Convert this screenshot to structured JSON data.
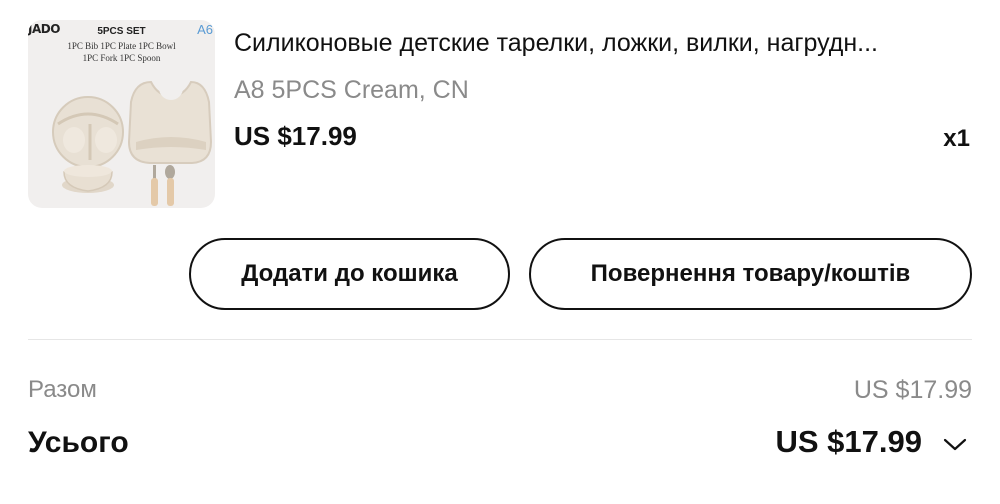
{
  "product": {
    "image": {
      "brand": "JADO",
      "corner_label": "A6",
      "set_label": "5PCS SET",
      "contents_line1": "1PC Bib   1PC Plate   1PC Bowl",
      "contents_line2": "1PC Fork   1PC Spoon"
    },
    "title": "Силиконовые детские тарелки, ложки, вилки, нагрудн...",
    "variant": "A8 5PCS Cream, CN",
    "price": "US $17.99",
    "quantity": "x1"
  },
  "actions": {
    "add_to_cart": "Додати до кошика",
    "return": "Повернення товару/коштів"
  },
  "summary": {
    "subtotal_label": "Разом",
    "subtotal_value": "US $17.99",
    "total_label": "Усього",
    "total_value": "US $17.99"
  },
  "colors": {
    "text": "#111111",
    "muted": "#8a8a8a",
    "image_bg": "#f1efee",
    "product_color": "#e6ddd0"
  },
  "icons": {
    "expand": "chevron-down-icon"
  }
}
